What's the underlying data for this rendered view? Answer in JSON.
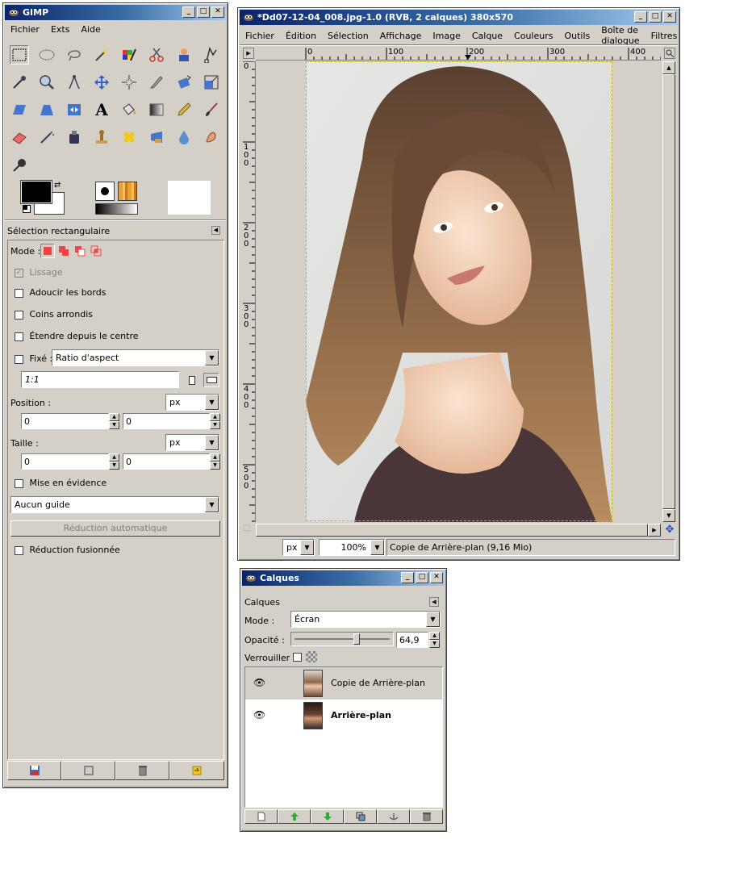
{
  "toolbox": {
    "title": "GIMP",
    "menu": [
      "Fichier",
      "Exts",
      "Aide"
    ],
    "tool_options_title": "Sélection rectangulaire",
    "mode_label": "Mode :",
    "lissage_label": "Lissage",
    "adoucir_label": "Adoucir les bords",
    "coins_label": "Coins arrondis",
    "etendre_label": "Étendre depuis le centre",
    "fixe_label": "Fixé :",
    "fixe_value": "Ratio d'aspect",
    "ratio_value": "1:1",
    "position_label": "Position :",
    "position_unit": "px",
    "position_x": "0",
    "position_y": "0",
    "taille_label": "Taille :",
    "taille_unit": "px",
    "taille_w": "0",
    "taille_h": "0",
    "mise_label": "Mise en évidence",
    "guide_value": "Aucun guide",
    "reduction_auto_label": "Réduction automatique",
    "reduction_fusion_label": "Réduction fusionnée"
  },
  "image_window": {
    "title": "*Dd07-12-04_008.jpg-1.0 (RVB, 2 calques) 380x570",
    "menu": [
      "Fichier",
      "Édition",
      "Sélection",
      "Affichage",
      "Image",
      "Calque",
      "Couleurs",
      "Outils",
      "Boîte de dialogue",
      "Filtres"
    ],
    "ruler_h_labels": [
      "0",
      "100",
      "200",
      "300",
      "400"
    ],
    "ruler_v_labels": [
      "0",
      "100",
      "200",
      "300",
      "400",
      "500"
    ],
    "unit": "px",
    "zoom": "100%",
    "status": "Copie de Arrière-plan (9,16 Mio)"
  },
  "layers": {
    "title": "Calques",
    "header": "Calques",
    "mode_label": "Mode :",
    "mode_value": "Écran",
    "opacity_label": "Opacité :",
    "opacity_value": "64,9",
    "opacity_fraction": 0.649,
    "lock_label": "Verrouiller :",
    "items": [
      {
        "name": "Copie de Arrière-plan",
        "visible": true,
        "selected": true
      },
      {
        "name": "Arrière-plan",
        "visible": true,
        "selected": false
      }
    ]
  },
  "colors": {
    "titlebar_start": "#0a246a",
    "titlebar_end": "#a6caf0",
    "chrome": "#d4d0c8"
  }
}
